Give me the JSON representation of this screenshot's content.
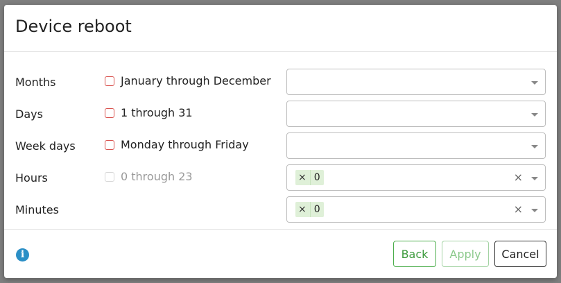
{
  "dialog": {
    "title": "Device reboot"
  },
  "rows": [
    {
      "label": "Months",
      "check_label": "January through December",
      "check_disabled": false,
      "tags": [],
      "clearable": false
    },
    {
      "label": "Days",
      "check_label": "1 through 31",
      "check_disabled": false,
      "tags": [],
      "clearable": false
    },
    {
      "label": "Week days",
      "check_label": "Monday through Friday",
      "check_disabled": false,
      "tags": [],
      "clearable": false
    },
    {
      "label": "Hours",
      "check_label": "0 through 23",
      "check_disabled": true,
      "tags": [
        "0"
      ],
      "clearable": true
    },
    {
      "label": "Minutes",
      "check_label": "",
      "check_disabled": false,
      "tags": [
        "0"
      ],
      "clearable": true
    }
  ],
  "icons": {
    "tag_remove": "×",
    "clear": "×",
    "info": "i"
  },
  "footer": {
    "back_label": "Back",
    "apply_label": "Apply",
    "cancel_label": "Cancel"
  },
  "colors": {
    "checkbox_border": "#d9534f",
    "tag_bg": "#dff0d8",
    "back_button": "#4cae4c",
    "info_icon": "#2b8fc6"
  }
}
